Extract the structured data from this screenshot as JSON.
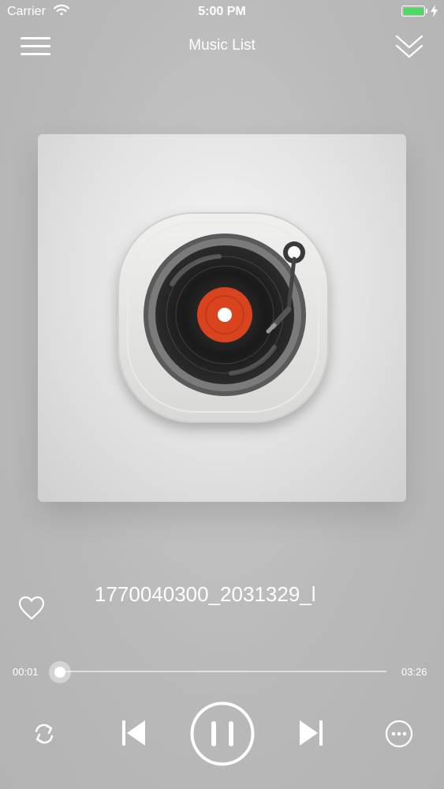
{
  "status_bar": {
    "carrier": "Carrier",
    "time": "5:00 PM",
    "battery_color": "#4cd964"
  },
  "nav": {
    "title": "Music List",
    "left_icon": "menu-icon",
    "right_icon": "chevron-double-down-icon"
  },
  "album": {
    "art_icon": "record-player-icon",
    "label_color": "#d9431e"
  },
  "track": {
    "title": "1770040300_2031329_l",
    "favorite_icon": "heart-outline-icon"
  },
  "progress": {
    "elapsed": "00:01",
    "duration": "03:26",
    "fraction": 0.005
  },
  "controls": {
    "repeat_icon": "repeat-icon",
    "prev_icon": "skip-previous-icon",
    "play_pause_icon": "pause-icon",
    "next_icon": "skip-next-icon",
    "more_icon": "more-horizontal-icon"
  }
}
